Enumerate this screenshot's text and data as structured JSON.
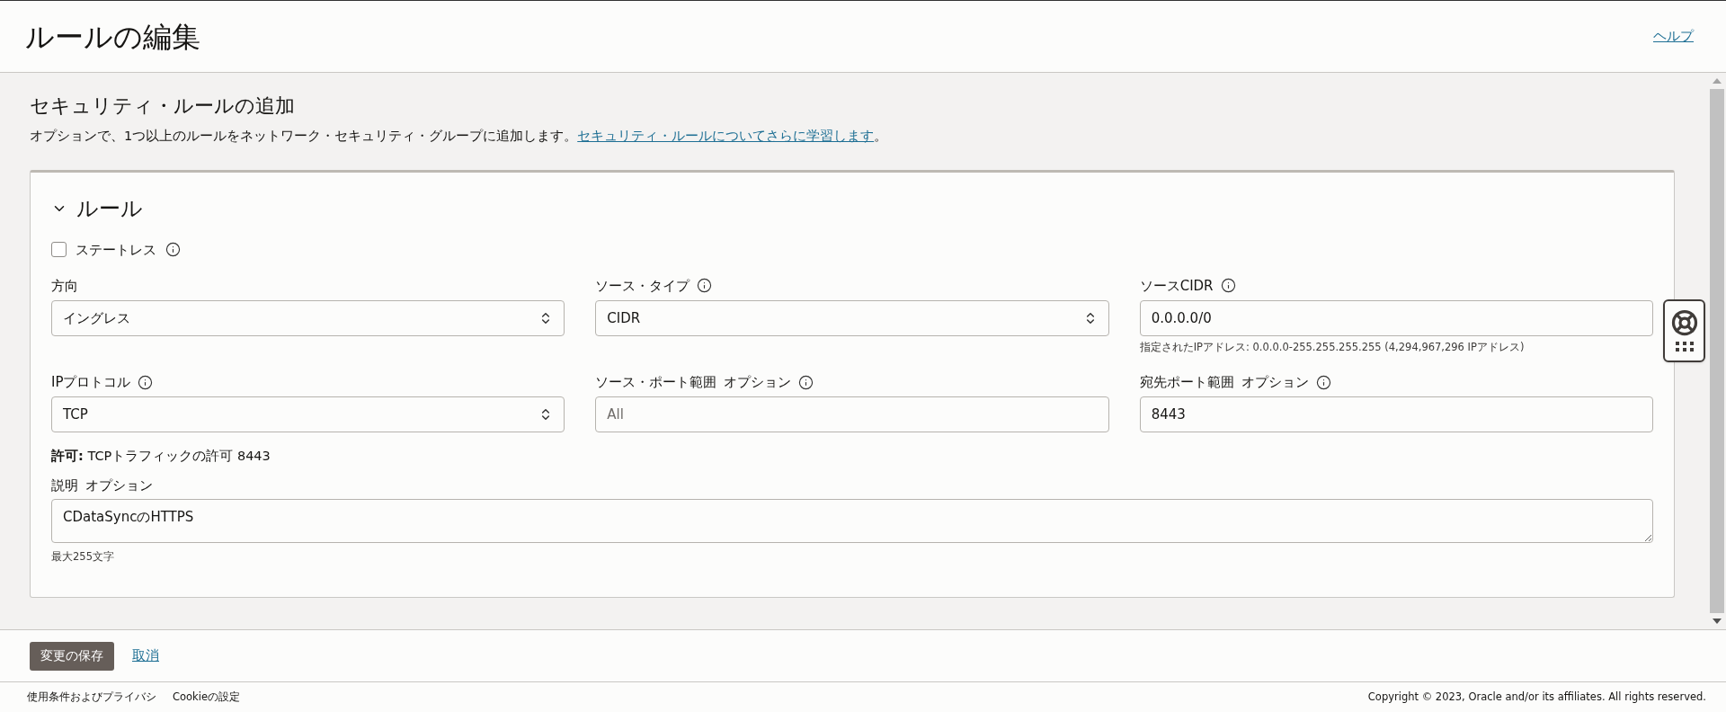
{
  "header": {
    "title": "ルールの編集",
    "help_link": "ヘルプ"
  },
  "section": {
    "title": "セキュリティ・ルールの追加",
    "description": "オプションで、1つ以上のルールをネットワーク・セキュリティ・グループに追加します。",
    "description_link": "セキュリティ・ルールについてさらに学習します",
    "description_end": "。"
  },
  "rule": {
    "title": "ルール",
    "expanded": true,
    "stateless": {
      "label": "ステートレス",
      "checked": false,
      "info": true
    },
    "fields": [
      {
        "label": "方向",
        "info": false,
        "kind": "select",
        "value": "イングレス"
      },
      {
        "label": "ソース・タイプ",
        "info": true,
        "kind": "select",
        "value": "CIDR"
      },
      {
        "label": "ソースCIDR",
        "info": true,
        "kind": "input",
        "value": "0.0.0.0/0",
        "hint": "指定されたIPアドレス: 0.0.0.0-255.255.255.255 (4,294,967,296 IPアドレス)"
      },
      {
        "label": "IPプロトコル",
        "info": true,
        "kind": "select",
        "value": "TCP"
      },
      {
        "label": "ソース・ポート範囲",
        "optional": "オプション",
        "info": true,
        "kind": "input",
        "placeholder": "All"
      },
      {
        "label": "宛先ポート範囲",
        "optional": "オプション",
        "info": true,
        "kind": "input",
        "value": "8443"
      }
    ],
    "permit": "**許可:** TCPトラフィックの許可 8443",
    "description": {
      "label": "説明",
      "optional": "オプション",
      "value": "CDataSyncのHTTPS",
      "hint": "最大255文字"
    }
  },
  "actions": {
    "save": "変更の保存",
    "cancel": "取消"
  },
  "footer": {
    "links": [
      "使用条件およびプライバシ",
      "Cookieの設定"
    ],
    "copyright": "Copyright © 2023, Oracle and/or its affiliates. All rights reserved."
  }
}
